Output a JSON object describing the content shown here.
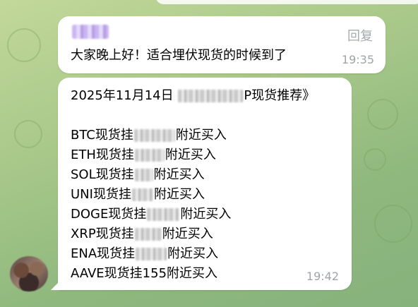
{
  "message1": {
    "reply_label": "回复",
    "text": "大家晚上好！适合埋伏现货的时候到了",
    "time": "19:35"
  },
  "message2": {
    "header_prefix": "2025年11月14日 ",
    "header_suffix": "P现货推荐》",
    "lines": [
      {
        "pre": "BTC现货挂",
        "post": "附近买入"
      },
      {
        "pre": "ETH现货挂",
        "post": "附近买入"
      },
      {
        "pre": "SOL现货挂",
        "post": "附近买入"
      },
      {
        "pre": "UNI现货挂",
        "post": "附近买入"
      },
      {
        "pre": "DOGE现货挂",
        "post": "附近买入"
      },
      {
        "pre": "XRP现货挂",
        "post": "附近买入"
      },
      {
        "pre": "ENA现货挂",
        "post": "附近买入"
      },
      {
        "full": "AAVE现货挂155附近买入"
      }
    ],
    "time": "19:42"
  },
  "colors": {
    "bubble": "#ffffff",
    "timestamp": "#a0a4a8",
    "background": "#a9c98a"
  },
  "icons": {
    "avatar": "user-avatar"
  }
}
